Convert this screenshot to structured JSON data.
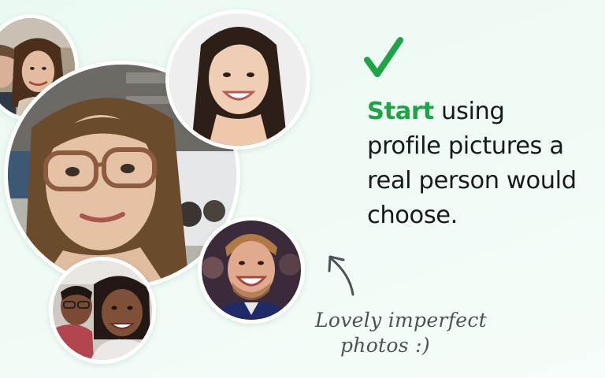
{
  "headline": {
    "accent_word": "Start",
    "rest_line_1": " using",
    "line_2": "profile pictures a",
    "line_3": "real person would",
    "line_4": "choose."
  },
  "caption": {
    "line_1": "Lovely imperfect",
    "line_2": "photos :)"
  },
  "icons": {
    "check": "check-mark-icon",
    "arrow": "curved-arrow-icon"
  },
  "colors": {
    "accent": "#1fa347",
    "text": "#17191c",
    "caption": "#4a5355",
    "background": "#eafaf1"
  }
}
